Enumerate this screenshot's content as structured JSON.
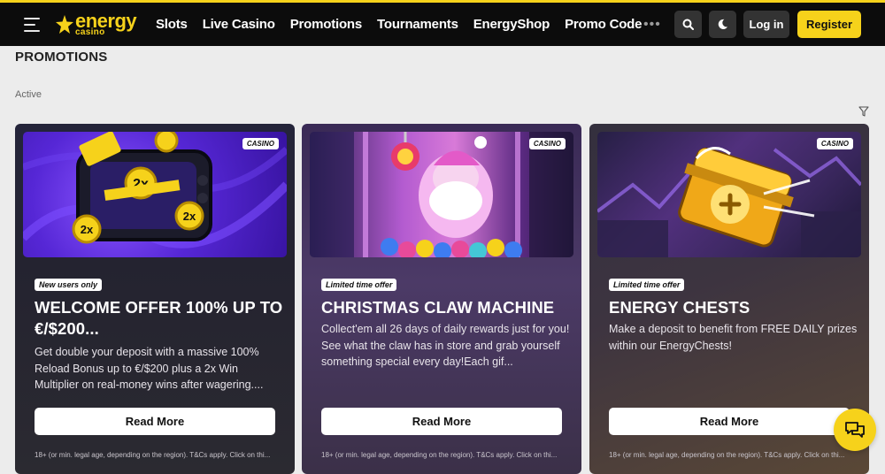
{
  "brand": {
    "name": "energy",
    "sub": "casino",
    "accent": "#f6d21b"
  },
  "nav": {
    "items": [
      {
        "label": "Slots"
      },
      {
        "label": "Live Casino"
      },
      {
        "label": "Promotions"
      },
      {
        "label": "Tournaments"
      },
      {
        "label": "EnergyShop"
      },
      {
        "label": "Promo Code"
      }
    ],
    "more": "•••",
    "login": "Log in",
    "register": "Register"
  },
  "page": {
    "title": "PROMOTIONS",
    "section": "Active"
  },
  "cards": [
    {
      "category": "CASINO",
      "tag": "New users only",
      "title": "WELCOME OFFER 100% UP TO €/$200...",
      "description": "Get double your deposit with a massive 100% Reload Bonus up to €/$200 plus a 2x Win Multiplier on real-money wins after wagering....",
      "button": "Read More",
      "disclaimer": "18+ (or min. legal age, depending on the region). T&Cs apply. Click on thi..."
    },
    {
      "category": "CASINO",
      "tag": "Limited time offer",
      "title": "CHRISTMAS CLAW MACHINE",
      "description": "Collect'em all 26 days of daily rewards just for you! See what the claw has in store and grab yourself something special every day!Each gif...",
      "button": "Read More",
      "disclaimer": "18+ (or min. legal age, depending on the region). T&Cs apply. Click on thi..."
    },
    {
      "category": "CASINO",
      "tag": "Limited time offer",
      "title": "ENERGY CHESTS",
      "description": "Make a deposit to benefit from FREE DAILY prizes within our EnergyChests!",
      "button": "Read More",
      "disclaimer": "18+ (or min. legal age, depending on the region). T&Cs apply. Click on thi..."
    }
  ]
}
